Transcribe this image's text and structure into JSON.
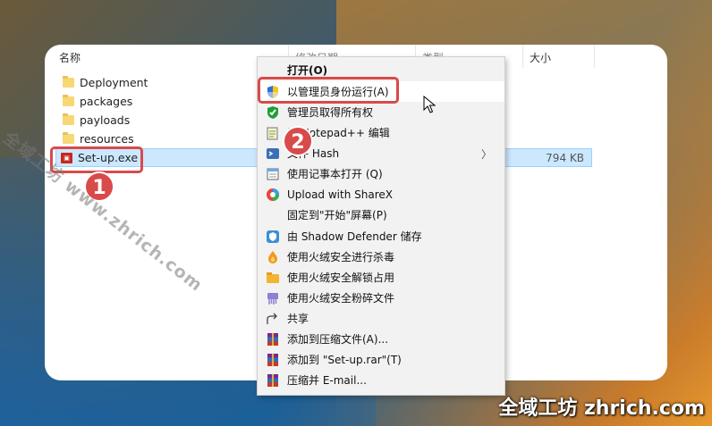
{
  "columns": {
    "name": "名称",
    "modified": "修改日期",
    "type": "类型",
    "size": "大小"
  },
  "files": [
    {
      "name": "Deployment",
      "kind": "folder"
    },
    {
      "name": "packages",
      "kind": "folder"
    },
    {
      "name": "payloads",
      "kind": "folder"
    },
    {
      "name": "resources",
      "kind": "folder"
    },
    {
      "name": "Set-up.exe",
      "kind": "exe",
      "size": "794 KB"
    }
  ],
  "menu": {
    "items": [
      {
        "label": "打开(O)",
        "icon": "none"
      },
      {
        "label": "以管理员身份运行(A)",
        "icon": "uac-shield-icon"
      },
      {
        "label": "管理员取得所有权",
        "icon": "green-check-shield-icon"
      },
      {
        "label": "用 Notepad++ 编辑",
        "icon": "notepadpp-icon"
      },
      {
        "label": "文件 Hash",
        "icon": "hash-icon"
      },
      {
        "label": "使用记事本打开 (Q)",
        "icon": "notepad-icon"
      },
      {
        "label": "Upload with ShareX",
        "icon": "sharex-icon"
      },
      {
        "label": "固定到\"开始\"屏幕(P)",
        "icon": "none"
      },
      {
        "label": "由 Shadow Defender 储存",
        "icon": "shadow-defender-icon"
      },
      {
        "label": "使用火绒安全进行杀毒",
        "icon": "huorong-antivirus-icon"
      },
      {
        "label": "使用火绒安全解锁占用",
        "icon": "huorong-unlock-icon"
      },
      {
        "label": "使用火绒安全粉碎文件",
        "icon": "huorong-shred-icon"
      },
      {
        "label": "共享",
        "icon": "share-icon"
      },
      {
        "label": "添加到压缩文件(A)...",
        "icon": "winrar-icon"
      },
      {
        "label": "添加到 \"Set-up.rar\"(T)",
        "icon": "winrar-icon"
      },
      {
        "label": "压缩并 E-mail...",
        "icon": "winrar-icon"
      }
    ]
  },
  "annotations": {
    "badge1": "1",
    "badge2": "2"
  },
  "watermark": "全域工坊 www.zhrich.com",
  "brand": "全域工坊 zhrich.com",
  "colors": {
    "callout": "#d94a4a",
    "selection": "#cce8ff"
  }
}
